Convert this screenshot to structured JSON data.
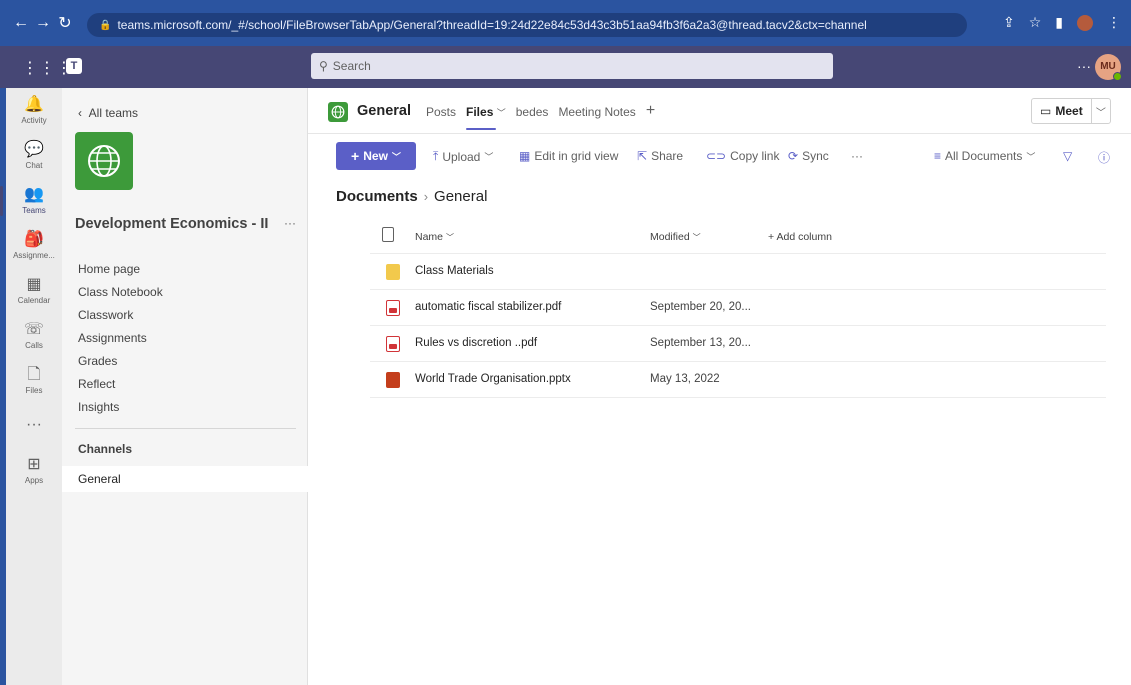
{
  "browser": {
    "url": "teams.microsoft.com/_#/school/FileBrowserTabApp/General?threadId=19:24d22e84c53d43c3b51aa94fb3f6a2a3@thread.tacv2&ctx=channel"
  },
  "header": {
    "search_placeholder": "Search",
    "more": "···",
    "avatar_initials": "MU"
  },
  "rail": {
    "items": [
      {
        "label": "Activity",
        "glyph": "🔔"
      },
      {
        "label": "Chat",
        "glyph": "💬"
      },
      {
        "label": "Teams",
        "glyph": "👥"
      },
      {
        "label": "Assignme...",
        "glyph": "🎒"
      },
      {
        "label": "Calendar",
        "glyph": "▦"
      },
      {
        "label": "Calls",
        "glyph": "☏"
      },
      {
        "label": "Files",
        "glyph": "🗋"
      },
      {
        "label": "",
        "glyph": "···"
      },
      {
        "label": "Apps",
        "glyph": "⊞"
      }
    ]
  },
  "team": {
    "back_label": "All teams",
    "name": "Development Economics - II",
    "more": "···",
    "nav": [
      "Home page",
      "Class Notebook",
      "Classwork",
      "Assignments",
      "Grades",
      "Reflect",
      "Insights"
    ],
    "channels_heading": "Channels",
    "channel": "General"
  },
  "main": {
    "channel_title": "General",
    "tabs": [
      "Posts",
      "Files",
      "bedes",
      "Meeting Notes"
    ],
    "meet_label": "Meet",
    "toolbar": {
      "new": "New",
      "upload": "Upload",
      "grid": "Edit in grid view",
      "share": "Share",
      "copy": "Copy link",
      "sync": "Sync",
      "more": "···",
      "view": "All Documents"
    },
    "breadcrumb": {
      "root": "Documents",
      "current": "General"
    },
    "table": {
      "col_name": "Name",
      "col_modified": "Modified",
      "add_column": "+ Add column",
      "rows": [
        {
          "name": "Class Materials",
          "modified": "",
          "type": "folder"
        },
        {
          "name": "automatic fiscal stabilizer.pdf",
          "modified": "September 20, 20...",
          "type": "pdf"
        },
        {
          "name": "Rules vs discretion ..pdf",
          "modified": "September 13, 20...",
          "type": "pdf"
        },
        {
          "name": "World Trade Organisation.pptx",
          "modified": "May 13, 2022",
          "type": "pptx"
        }
      ]
    }
  }
}
